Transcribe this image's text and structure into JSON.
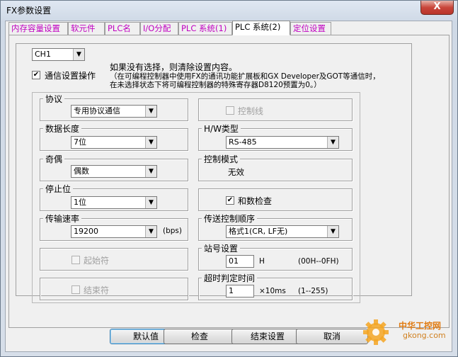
{
  "window": {
    "title": "FX参数设置",
    "close": "X"
  },
  "tabs": [
    {
      "label": "内存容量设置"
    },
    {
      "label": "软元件"
    },
    {
      "label": "PLC名"
    },
    {
      "label": "I/O分配"
    },
    {
      "label": "PLC 系统(1)"
    },
    {
      "label": "PLC 系统(2)"
    },
    {
      "label": "定位设置"
    }
  ],
  "channel": {
    "value": "CH1"
  },
  "comm": {
    "checkbox_label": "通信设置操作",
    "checked": true,
    "notice_line1": "如果没有选择，则清除设置内容。",
    "notice_line2": "（在可编程控制器中使用FX的通讯功能扩展板和GX Developer及GOT等通信时，",
    "notice_line3": "在未选择状态下将可编程控制器的特殊寄存器D8120预置为0。）"
  },
  "groups": {
    "protocol": {
      "label": "协议",
      "value": "专用协议通信"
    },
    "control_line": {
      "label": "控制线"
    },
    "data_length": {
      "label": "数据长度",
      "value": "7位"
    },
    "hw_type": {
      "label": "H/W类型",
      "value": "RS-485"
    },
    "parity": {
      "label": "奇偶",
      "value": "偶数"
    },
    "control_mode": {
      "label": "控制模式",
      "value": "无效"
    },
    "stop_bit": {
      "label": "停止位",
      "value": "1位"
    },
    "checksum": {
      "label": "和数检查"
    },
    "baud_rate": {
      "label": "传输速率",
      "value": "19200",
      "unit": "(bps)"
    },
    "transfer_seq": {
      "label": "传送控制顺序",
      "value": "格式1(CR, LF无)"
    },
    "start_char": {
      "label": "起始符"
    },
    "station": {
      "label": "站号设置",
      "value": "01",
      "unit": "H",
      "range": "(00H--0FH)"
    },
    "end_char": {
      "label": "结束符"
    },
    "timeout": {
      "label": "超时判定时间",
      "value": "1",
      "unit": "×10ms",
      "range": "(1--255)"
    }
  },
  "buttons": {
    "default": "默认值",
    "check": "检查",
    "finish": "结束设置",
    "cancel": "取消"
  },
  "watermark": {
    "line1": "中华工控网",
    "line2": "gkong.com"
  }
}
